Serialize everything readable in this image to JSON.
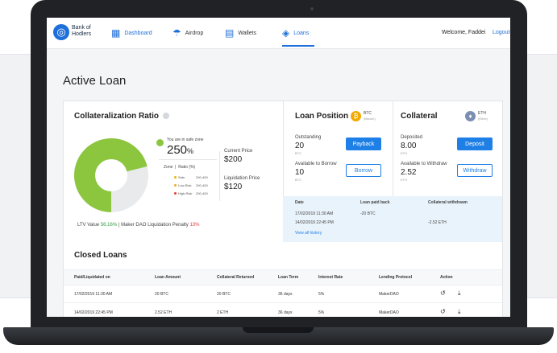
{
  "nav": {
    "logo_line1": "Bank of",
    "logo_line2": "Hodlers",
    "items": [
      {
        "label": "Dashboard",
        "icon": "dashboard-icon"
      },
      {
        "label": "Airdrop",
        "icon": "airdrop-icon"
      },
      {
        "label": "Wallets",
        "icon": "wallet-icon"
      },
      {
        "label": "Loans",
        "icon": "loans-icon"
      }
    ],
    "welcome": "Welcome, Faddei",
    "logout": "Logout"
  },
  "page": {
    "title": "Active Loan"
  },
  "collateralization": {
    "title": "Collateralization Ratio",
    "zone_text": "You are in safe zone",
    "ratio_number": "250",
    "ratio_unit": "%",
    "ratio_fraction": 0.71,
    "zone_header": "Zone",
    "ratio_header": "Ratio (%)",
    "zones": [
      {
        "name": "Safe",
        "range": "200-400",
        "color": "#f5b400"
      },
      {
        "name": "Low-Risk",
        "range": "200-400",
        "color": "#f5a623"
      },
      {
        "name": "High-Risk",
        "range": "200-400",
        "color": "#e53935"
      }
    ],
    "current_price_label": "Current Price",
    "current_price": "$200",
    "liquidation_price_label": "Liquidation Price",
    "liquidation_price": "$120",
    "ltv_prefix": "LTV Value",
    "ltv_value": "56.16%",
    "ltv_mid": "| Maker DAO Liquidation Penalty",
    "penalty_value": "13%",
    "donut_color": "#8cc63f",
    "donut_bg": "#e9eaec"
  },
  "loan_position": {
    "title": "Loan Position",
    "coin_symbol": "BTC",
    "coin_name": "(Bitcoin)",
    "outstanding_label": "Outstanding",
    "outstanding_value": "20",
    "outstanding_unit": "BTC",
    "available_label": "Available to Borrow",
    "available_value": "10",
    "available_unit": "BTC",
    "payback_label": "Payback",
    "borrow_label": "Borrow"
  },
  "collateral": {
    "title": "Collateral",
    "coin_symbol": "ETH",
    "coin_name": "(Ether)",
    "deposited_label": "Deposited",
    "deposited_value": "8.00",
    "deposited_unit": "ETH",
    "withdraw_avail_label": "Available to Withdraw",
    "withdraw_avail_value": "2.52",
    "withdraw_avail_unit": "ETH",
    "deposit_label": "Deposit",
    "withdraw_label": "Withdraw"
  },
  "history": {
    "headers": [
      "Date",
      "Loan paid back",
      "Collateral withdrawn"
    ],
    "rows": [
      [
        "17/02/2019 11:30 AM",
        "-20 BTC",
        ""
      ],
      [
        "14/02/2019 22:45 PM",
        "",
        "-2.52 ETH"
      ]
    ],
    "view_all": "View all history"
  },
  "closed_loans": {
    "title": "Closed Loans",
    "headers": [
      "Paid/Liquidated on",
      "Loan Amount",
      "Collateral Returned",
      "Loan Term",
      "Interest Rate",
      "Lending Protocol",
      "Action"
    ],
    "rows": [
      [
        "17/02/2019 11:30 AM",
        "20 BTC",
        "20 BTC",
        "36 days",
        "5%",
        "MakerDAO"
      ],
      [
        "14/02/2019 22:45 PM",
        "2.52 ETH",
        "2 ETH",
        "36 days",
        "5%",
        "MakerDAO"
      ]
    ]
  },
  "colors": {
    "accent": "#1e7fe6",
    "success": "#2e9e3e",
    "danger": "#e53935",
    "history_bg": "#e9f3fb"
  }
}
